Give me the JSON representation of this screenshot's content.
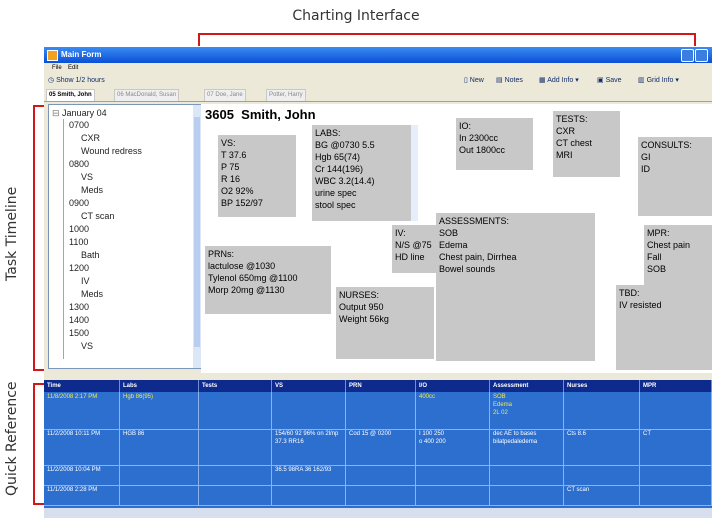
{
  "annotations": {
    "charting_interface": "Charting Interface",
    "task_timeline": "Task Timeline",
    "quick_reference": "Quick Reference"
  },
  "window": {
    "title": "Main Form",
    "menu": [
      "File",
      "Edit"
    ],
    "toolbar": {
      "show_range": "Show 1/2 hours",
      "new": "New",
      "notes": "Notes",
      "add_info": "Add Info",
      "save": "Save",
      "grid_info": "Grid Info"
    },
    "patient_tabs": [
      "05 Smith, John",
      "06 MacDonald, Susan",
      "07 Doe, Jane",
      "Potter, Harry"
    ],
    "active_tab": 0
  },
  "timeline": [
    "January 04",
    "0700",
    "CXR",
    "Wound redress",
    "0800",
    "VS",
    "Meds",
    "0900",
    "CT scan",
    "1000",
    "1100",
    "Bath",
    "1200",
    "IV",
    "Meds",
    "1300",
    "1400",
    "1500",
    "VS"
  ],
  "patient": {
    "header": "3605  Smith, John",
    "vs": [
      "VS:",
      "T 37.6",
      "P 75",
      "R 16",
      "O2 92%",
      "BP 152/97"
    ],
    "labs": [
      "LABS:",
      "BG @0730 5.5",
      "Hgb 65(74)",
      "Cr 144(196)",
      "WBC 3.2(14.4)",
      "urine spec",
      "stool spec"
    ],
    "io": [
      "IO:",
      "In 2300cc",
      "Out 1800cc"
    ],
    "tests": [
      "TESTS:",
      "CXR",
      "CT chest",
      "MRI"
    ],
    "consults": [
      "CONSULTS:",
      "GI",
      "ID"
    ],
    "iv": [
      "IV:",
      "N/S @75",
      "HD line"
    ],
    "assessments": [
      "ASSESSMENTS:",
      "SOB",
      "Edema",
      "Chest pain, Dirrhea",
      "Bowel sounds"
    ],
    "mpr": [
      "MPR:",
      "Chest pain",
      "Fall",
      "SOB"
    ],
    "prns": [
      "PRNs:",
      "lactulose @1030",
      "Tylenol 650mg @1100",
      "Morp 20mg @1130"
    ],
    "nurses": [
      "NURSES:",
      "Output 950",
      "Weight 56kg"
    ],
    "tbd": [
      "TBD:",
      "IV resisted"
    ]
  },
  "quick_reference": {
    "columns": [
      "Time",
      "Labs",
      "Tests",
      "VS",
      "PRN",
      "I/O",
      "Assessment",
      "Nurses",
      "MPR"
    ],
    "rows": [
      [
        "11/8/2008 2:17 PM",
        "Hgb 86(95)",
        "",
        "",
        "",
        "400cc",
        "SOB\nEdema\n2L 02",
        "",
        ""
      ],
      [
        "11/2/2008 10:11 PM",
        "HGB 86",
        "",
        "154/60 92 96% on 2l/np 37.3 RR16",
        "Cod 15 @ 0200",
        "I 100 250\no 400 200",
        "dec AE to bases bilatpedaledema",
        "Cts 8.6",
        "CT"
      ],
      [
        "11/2/2008 10:04 PM",
        "",
        "",
        "36.5 98RA 36 162/93",
        "",
        "",
        "",
        "",
        ""
      ],
      [
        "11/1/2008 2:28 PM",
        "",
        "",
        "",
        "",
        "",
        "",
        "CT scan",
        ""
      ]
    ]
  }
}
